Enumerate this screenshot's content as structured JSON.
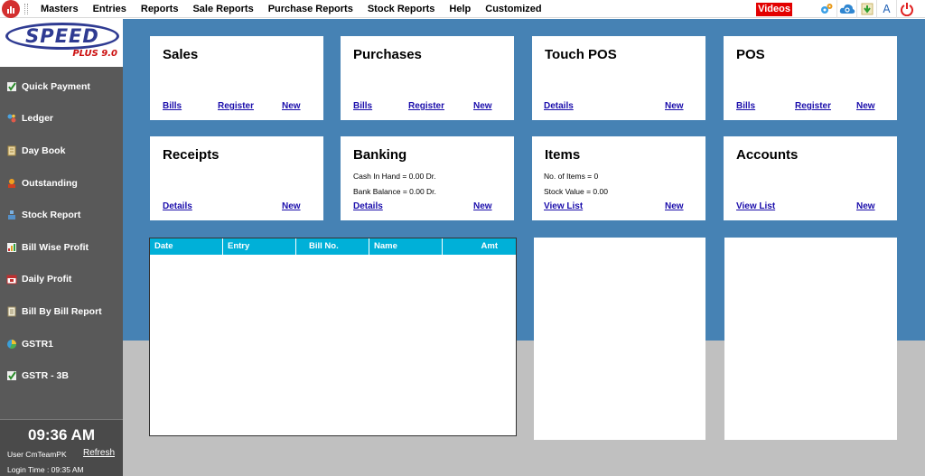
{
  "menu": [
    "Masters",
    "Entries",
    "Reports",
    "Sale Reports",
    "Purchase Reports",
    "Stock Reports",
    "Help",
    "Customized"
  ],
  "videos_label": "Videos",
  "toolbar": {
    "font_label": "A"
  },
  "brand": {
    "name": "SPEED",
    "edition": "PLUS 9.0"
  },
  "sidebar": {
    "items": [
      {
        "label": "Quick Payment",
        "icon": "quick-payment-icon"
      },
      {
        "label": "Ledger",
        "icon": "ledger-icon"
      },
      {
        "label": "Day Book",
        "icon": "day-book-icon"
      },
      {
        "label": "Outstanding",
        "icon": "outstanding-icon"
      },
      {
        "label": "Stock Report",
        "icon": "stock-report-icon"
      },
      {
        "label": "Bill Wise Profit",
        "icon": "bill-wise-profit-icon"
      },
      {
        "label": "Daily Profit",
        "icon": "daily-profit-icon"
      },
      {
        "label": "Bill By Bill Report",
        "icon": "bill-by-bill-report-icon"
      },
      {
        "label": "GSTR1",
        "icon": "gstr1-icon"
      },
      {
        "label": "GSTR - 3B",
        "icon": "gstr-3b-icon"
      }
    ],
    "time": "09:36 AM",
    "user": "User CmTeamPK",
    "refresh": "Refresh",
    "login": "Login Time : 09:35 AM"
  },
  "cards": {
    "sales": {
      "title": "Sales",
      "links": [
        "Bills",
        "Register",
        "New"
      ]
    },
    "purchases": {
      "title": "Purchases",
      "links": [
        "Bills",
        "Register",
        "New"
      ]
    },
    "touch_pos": {
      "title": "Touch POS",
      "links": [
        "Details",
        "New"
      ]
    },
    "pos": {
      "title": "POS",
      "links": [
        "Bills",
        "Register",
        "New"
      ]
    },
    "receipts": {
      "title": "Receipts",
      "links": [
        "Details",
        "New"
      ]
    },
    "banking": {
      "title": "Banking",
      "cash": "Cash In Hand = 0.00 Dr.",
      "bank": "Bank Balance = 0.00 Dr.",
      "links": [
        "Details",
        "New"
      ]
    },
    "items": {
      "title": "Items",
      "count": "No. of Items = 0",
      "value": "Stock Value = 0.00",
      "links": [
        "View List",
        "New"
      ]
    },
    "accounts": {
      "title": "Accounts",
      "links": [
        "View List",
        "New"
      ]
    }
  },
  "table": {
    "columns": [
      "Date",
      "Entry",
      "Bill No.",
      "Name",
      "Amt"
    ]
  },
  "colors": {
    "main_bg": "#4682b4",
    "sidebar_bg": "#595959",
    "table_header": "#00b0d8",
    "videos": "#e30000",
    "link": "#1a0dab"
  }
}
